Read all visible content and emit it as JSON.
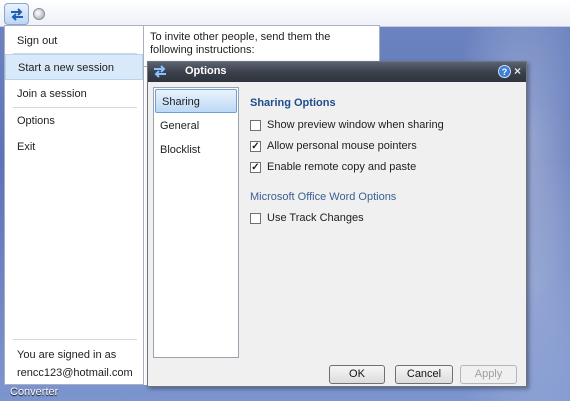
{
  "toolbar": {
    "app_icon": "swap-arrows-icon",
    "arrow_icon": "circle-arrow-icon"
  },
  "menu": {
    "items": [
      {
        "label": "Sign out"
      },
      {
        "label": "Start a new session",
        "selected": true
      },
      {
        "label": "Join a session"
      },
      {
        "label": "Options"
      },
      {
        "label": "Exit"
      }
    ],
    "signed_in_label": "You are signed in as",
    "signed_in_email": "rencc123@hotmail.com"
  },
  "instructions": {
    "text": "To invite other people, send them the following instructions:"
  },
  "dialog": {
    "title": "Options",
    "help_label": "?",
    "close_label": "×",
    "tabs": [
      {
        "label": "Sharing",
        "selected": true
      },
      {
        "label": "General"
      },
      {
        "label": "Blocklist"
      }
    ],
    "sharing_title": "Sharing Options",
    "options": [
      {
        "label": "Show preview window when sharing",
        "checked": false,
        "mark": ""
      },
      {
        "label": "Allow personal mouse pointers",
        "checked": true,
        "mark": "✓"
      },
      {
        "label": "Enable remote copy and paste",
        "checked": true,
        "mark": "✓"
      }
    ],
    "word_title": "Microsoft Office Word Options",
    "word_options": [
      {
        "label": "Use Track Changes",
        "checked": false,
        "mark": ""
      }
    ],
    "buttons": {
      "ok": "OK",
      "cancel": "Cancel",
      "apply": "Apply"
    }
  },
  "desktop": {
    "icon_label": "Converter"
  }
}
